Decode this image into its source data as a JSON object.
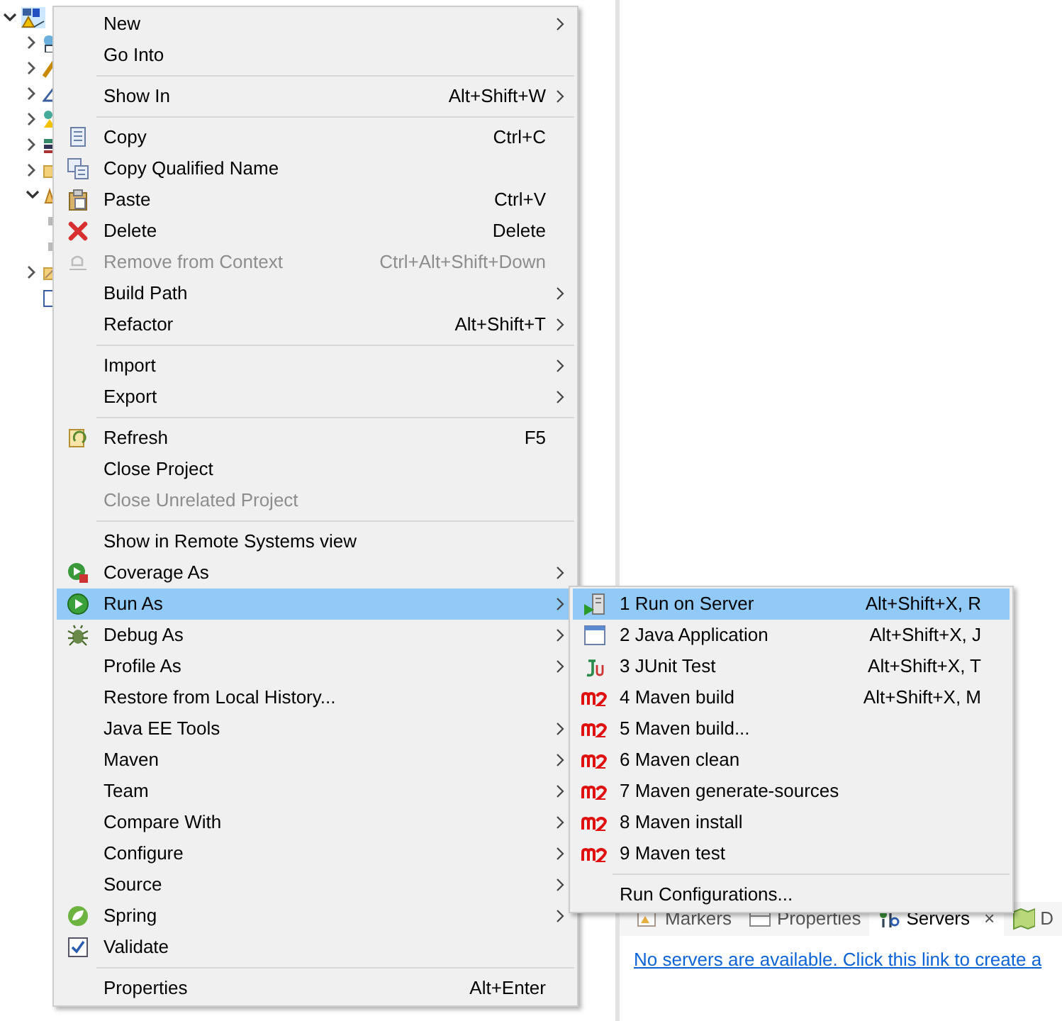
{
  "tree": [
    {
      "selected": true,
      "expanded": true,
      "children": [
        {
          "expanded": false
        },
        {
          "expanded": false
        },
        {
          "expanded": false
        },
        {
          "expanded": false
        },
        {
          "expanded": false
        },
        {
          "expanded": false
        },
        {
          "expanded": true,
          "children": [
            {
              "kind": "leaf"
            },
            {
              "kind": "leaf"
            }
          ]
        },
        {
          "expanded": false
        },
        {
          "kind": "leaf"
        }
      ]
    }
  ],
  "context_menu": {
    "items": [
      {
        "kind": "item",
        "label": "New",
        "submenu": true
      },
      {
        "kind": "item",
        "label": "Go Into"
      },
      {
        "kind": "separator"
      },
      {
        "kind": "item",
        "label": "Show In",
        "shortcut": "Alt+Shift+W",
        "submenu": true
      },
      {
        "kind": "separator"
      },
      {
        "kind": "item",
        "label": "Copy",
        "shortcut": "Ctrl+C"
      },
      {
        "kind": "item",
        "label": "Copy Qualified Name"
      },
      {
        "kind": "item",
        "label": "Paste",
        "shortcut": "Ctrl+V"
      },
      {
        "kind": "item",
        "label": "Delete",
        "shortcut": "Delete"
      },
      {
        "kind": "item",
        "label": "Remove from Context",
        "shortcut": "Ctrl+Alt+Shift+Down",
        "disabled": true
      },
      {
        "kind": "item",
        "label": "Build Path",
        "submenu": true
      },
      {
        "kind": "item",
        "label": "Refactor",
        "shortcut": "Alt+Shift+T",
        "submenu": true
      },
      {
        "kind": "separator"
      },
      {
        "kind": "item",
        "label": "Import",
        "submenu": true
      },
      {
        "kind": "item",
        "label": "Export",
        "submenu": true
      },
      {
        "kind": "separator"
      },
      {
        "kind": "item",
        "label": "Refresh",
        "shortcut": "F5"
      },
      {
        "kind": "item",
        "label": "Close Project"
      },
      {
        "kind": "item",
        "label": "Close Unrelated Project",
        "disabled": true
      },
      {
        "kind": "separator"
      },
      {
        "kind": "item",
        "label": "Show in Remote Systems view"
      },
      {
        "kind": "item",
        "label": "Coverage As",
        "submenu": true
      },
      {
        "kind": "item",
        "label": "Run As",
        "submenu": true,
        "selected": true
      },
      {
        "kind": "item",
        "label": "Debug As",
        "submenu": true
      },
      {
        "kind": "item",
        "label": "Profile As",
        "submenu": true
      },
      {
        "kind": "item",
        "label": "Restore from Local History..."
      },
      {
        "kind": "item",
        "label": "Java EE Tools",
        "submenu": true
      },
      {
        "kind": "item",
        "label": "Maven",
        "submenu": true
      },
      {
        "kind": "item",
        "label": "Team",
        "submenu": true
      },
      {
        "kind": "item",
        "label": "Compare With",
        "submenu": true
      },
      {
        "kind": "item",
        "label": "Configure",
        "submenu": true
      },
      {
        "kind": "item",
        "label": "Source",
        "submenu": true
      },
      {
        "kind": "item",
        "label": "Spring",
        "submenu": true
      },
      {
        "kind": "item",
        "label": "Validate"
      },
      {
        "kind": "separator"
      },
      {
        "kind": "item",
        "label": "Properties",
        "shortcut": "Alt+Enter"
      }
    ]
  },
  "run_as_submenu": {
    "items": [
      {
        "kind": "item",
        "label": "1 Run on Server",
        "shortcut": "Alt+Shift+X, R",
        "selected": true
      },
      {
        "kind": "item",
        "label": "2 Java Application",
        "shortcut": "Alt+Shift+X, J"
      },
      {
        "kind": "item",
        "label": "3 JUnit Test",
        "shortcut": "Alt+Shift+X, T"
      },
      {
        "kind": "item",
        "label": "4 Maven build",
        "shortcut": "Alt+Shift+X, M"
      },
      {
        "kind": "item",
        "label": "5 Maven build..."
      },
      {
        "kind": "item",
        "label": "6 Maven clean"
      },
      {
        "kind": "item",
        "label": "7 Maven generate-sources"
      },
      {
        "kind": "item",
        "label": "8 Maven install"
      },
      {
        "kind": "item",
        "label": "9 Maven test"
      },
      {
        "kind": "separator"
      },
      {
        "kind": "item",
        "label": "Run Configurations..."
      }
    ]
  },
  "bottom_panel": {
    "tabs": [
      {
        "label": "Markers",
        "selected": false
      },
      {
        "label": "Properties",
        "selected": false
      },
      {
        "label": "Servers",
        "selected": true,
        "close": "×"
      },
      {
        "label": "D",
        "selected": false
      }
    ],
    "link": "No servers are available. Click this link to create a"
  }
}
